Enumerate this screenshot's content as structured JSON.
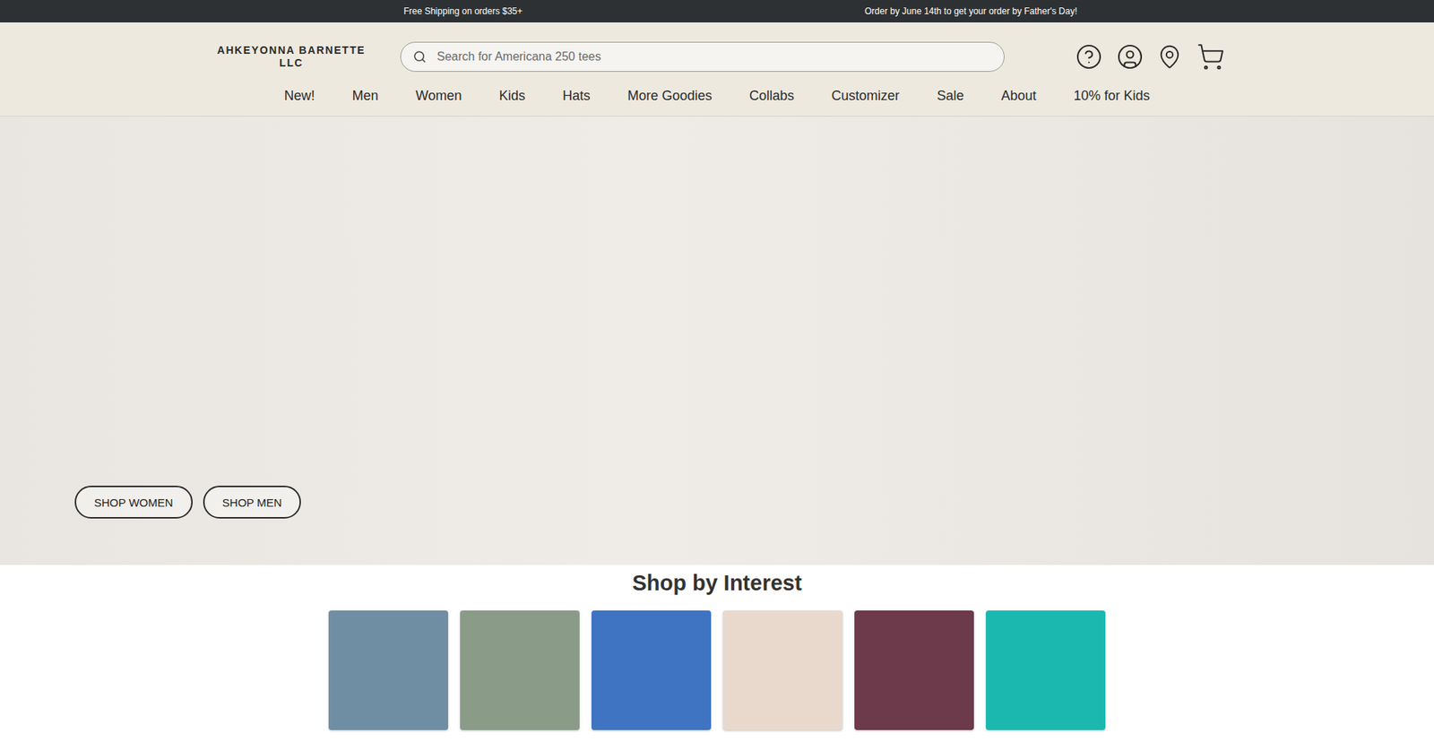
{
  "announcement_bar": {
    "messages": [
      "Free Shipping on orders $35+",
      "Order by June 14th to get your order by Father's Day!"
    ]
  },
  "header": {
    "logo": "AHKEYONNA BARNETTE LLC",
    "search": {
      "placeholder": "Search for Americana 250 tees"
    }
  },
  "nav": {
    "items": [
      "New!",
      "Men",
      "Women",
      "Kids",
      "Hats",
      "More Goodies",
      "Collabs",
      "Customizer",
      "Sale",
      "About",
      "10% for Kids"
    ]
  },
  "hero": {
    "buttons": [
      "SHOP WOMEN",
      "SHOP MEN"
    ]
  },
  "interests": {
    "title": "Shop by Interest",
    "tiles": [
      {
        "color": "#6f8ea3"
      },
      {
        "color": "#8a9b88"
      },
      {
        "color": "#3f74c2"
      },
      {
        "color": "#e9d9cd"
      },
      {
        "color": "#6d3a4b"
      },
      {
        "color": "#1bb8b0"
      }
    ]
  }
}
